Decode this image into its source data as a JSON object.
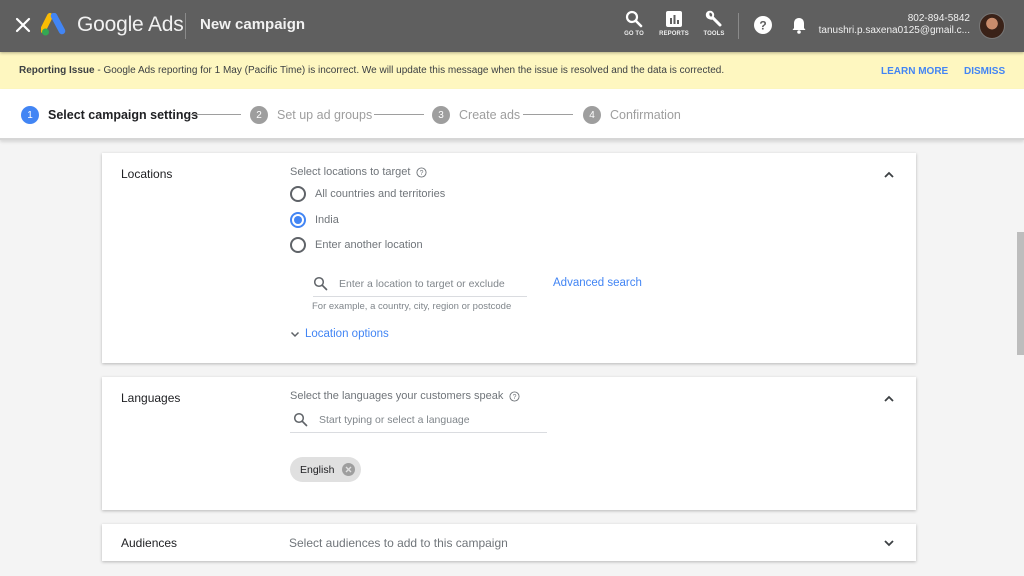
{
  "topbar": {
    "brand": "Google Ads",
    "page_title": "New campaign",
    "tools": [
      {
        "label": "GO TO",
        "icon": "search-icon"
      },
      {
        "label": "REPORTS",
        "icon": "bar-chart-icon"
      },
      {
        "label": "TOOLS",
        "icon": "wrench-icon"
      }
    ],
    "help_icon": "help-icon",
    "notifications_icon": "bell-icon",
    "account": {
      "phone": "802-894-5842",
      "email": "tanushri.p.saxena0125@gmail.c..."
    }
  },
  "banner": {
    "title": "Reporting Issue",
    "message": " - Google Ads reporting for 1 May (Pacific Time) is incorrect. We will update this message when the issue is resolved and the data is corrected.",
    "learn_more": "LEARN MORE",
    "dismiss": "DISMISS",
    "background": "#fef7c0"
  },
  "stepper": {
    "steps": [
      {
        "number": "1",
        "label": "Select campaign settings",
        "active": true
      },
      {
        "number": "2",
        "label": "Set up ad groups",
        "active": false
      },
      {
        "number": "3",
        "label": "Create ads",
        "active": false
      },
      {
        "number": "4",
        "label": "Confirmation",
        "active": false
      }
    ]
  },
  "locations": {
    "title": "Locations",
    "prompt": "Select locations to target",
    "options": [
      {
        "label": "All countries and territories",
        "selected": false
      },
      {
        "label": "India",
        "selected": true
      },
      {
        "label": "Enter another location",
        "selected": false
      }
    ],
    "search_placeholder": "Enter a location to target or exclude",
    "search_value": "",
    "hint": "For example, a country, city, region or postcode",
    "advanced_search": "Advanced search",
    "location_options": "Location options",
    "expanded": true
  },
  "languages": {
    "title": "Languages",
    "prompt": "Select the languages your customers speak",
    "search_placeholder": "Start typing or select a language",
    "search_value": "",
    "selected": [
      "English"
    ],
    "expanded": true
  },
  "audiences": {
    "title": "Audiences",
    "prompt": "Select audiences to add to this campaign",
    "expanded": false
  },
  "colors": {
    "accent": "#4285f4",
    "topbar": "#5f5f5f",
    "page_background": "#f4f4f4"
  }
}
